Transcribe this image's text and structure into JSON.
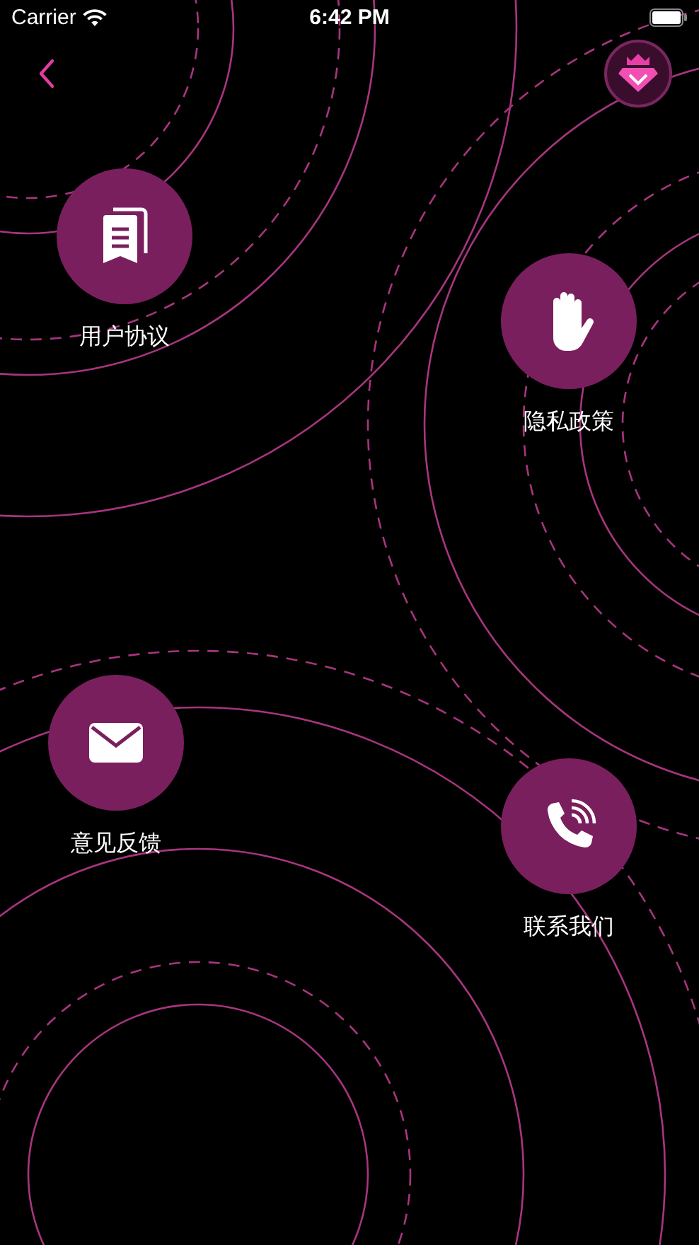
{
  "status_bar": {
    "carrier": "Carrier",
    "time": "6:42 PM"
  },
  "menu": [
    {
      "label": "用户协议",
      "kind": "document"
    },
    {
      "label": "隐私政策",
      "kind": "hand"
    },
    {
      "label": "意见反馈",
      "kind": "mail"
    },
    {
      "label": "联系我们",
      "kind": "phone"
    }
  ]
}
